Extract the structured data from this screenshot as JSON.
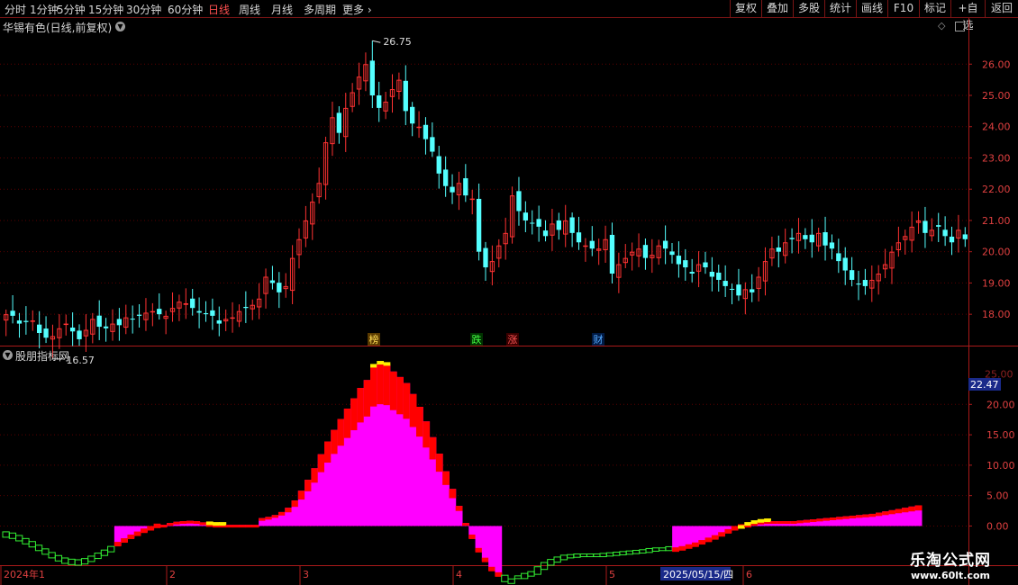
{
  "toolbar": {
    "periods": [
      "分时",
      "1分钟",
      "5分钟",
      "15分钟",
      "30分钟",
      "60分钟",
      "日线",
      "周线",
      "月线",
      "多周期",
      "更多"
    ],
    "active_period": "日线",
    "right_buttons": [
      "复权",
      "叠加",
      "多股",
      "统计",
      "画线",
      "F10",
      "标记",
      "+自选",
      "返回"
    ]
  },
  "main": {
    "title": "华锡有色(日线,前复权)",
    "high_label": "26.75",
    "low_label": "16.57",
    "y_ticks": [
      "26.00",
      "25.00",
      "24.00",
      "23.00",
      "22.00",
      "21.00",
      "20.00",
      "19.00",
      "18.00"
    ],
    "event_markers": [
      {
        "text": "榜",
        "color": "#ffdd55",
        "bg": "#5a3a00"
      },
      {
        "text": "跌",
        "color": "#44ff44",
        "bg": "#003300"
      },
      {
        "text": "涨",
        "color": "#ff5555",
        "bg": "#3a0000"
      },
      {
        "text": "财",
        "color": "#55aaff",
        "bg": "#001a44"
      }
    ]
  },
  "indicator": {
    "title": "股朋指标网",
    "current_value": "22.47",
    "y_ticks": [
      "20.00",
      "15.00",
      "10.00",
      "5.00",
      "0.00"
    ],
    "y_top_partial": "25.00"
  },
  "x_axis": {
    "labels": [
      "2024年1",
      "2",
      "3",
      "4",
      "5",
      "6"
    ],
    "cursor_date": "2025/05/15/四"
  },
  "watermark": {
    "cn": "乐淘公式网",
    "url": "www.60lt.com"
  },
  "colors": {
    "up": "#ff3232",
    "down": "#54ffff",
    "grid": "#5a0000",
    "axis": "#aa1a1a",
    "magenta": "#ff00ff",
    "red": "#ff0000",
    "yellow": "#ffee00",
    "green": "#33ee33"
  },
  "chart_data": {
    "type": "candlestick",
    "y_range": [
      17.4,
      26.9
    ],
    "high_value": 26.75,
    "low_value": 16.57,
    "close": [
      18.0,
      17.95,
      17.7,
      17.75,
      17.8,
      17.4,
      17.25,
      17.3,
      17.55,
      17.7,
      17.45,
      17.2,
      17.5,
      17.85,
      17.6,
      17.55,
      17.7,
      17.65,
      17.9,
      17.85,
      17.95,
      18.05,
      18.1,
      18.0,
      17.95,
      18.2,
      18.4,
      18.35,
      18.2,
      18.05,
      18.0,
      17.95,
      17.7,
      17.85,
      17.9,
      18.1,
      18.2,
      18.3,
      18.5,
      19.2,
      19.0,
      18.7,
      18.9,
      19.8,
      20.4,
      21.0,
      21.6,
      22.2,
      23.5,
      24.3,
      23.8,
      24.6,
      25.1,
      25.6,
      26.0,
      25.0,
      24.6,
      24.8,
      25.2,
      25.5,
      24.5,
      24.1,
      24.0,
      23.6,
      23.2,
      22.5,
      22.1,
      21.9,
      22.2,
      21.8,
      21.7,
      20.0,
      19.5,
      19.7,
      20.2,
      20.6,
      21.8,
      21.3,
      21.0,
      20.9,
      20.8,
      20.5,
      20.9,
      20.7,
      21.0,
      20.6,
      20.3,
      20.2,
      20.1,
      20.1,
      20.4,
      19.3,
      19.6,
      19.8,
      20.0,
      20.1,
      19.8,
      19.9,
      20.2,
      20.1,
      19.9,
      19.6,
      19.5,
      19.3,
      19.6,
      19.5,
      19.2,
      19.1,
      18.9,
      18.8,
      18.6,
      18.8,
      18.7,
      19.2,
      19.7,
      20.1,
      20.0,
      20.3,
      20.4,
      20.6,
      20.4,
      20.3,
      20.6,
      20.2,
      20.1,
      19.7,
      19.4,
      19.1,
      18.95,
      18.9,
      19.1,
      19.3,
      19.6,
      20.0,
      20.3,
      20.5,
      20.8,
      21.0,
      20.6,
      20.7,
      20.8,
      20.5,
      20.3,
      20.7,
      20.4
    ],
    "indicator": {
      "type": "stepped-area",
      "y_range": [
        -6,
        27
      ],
      "y_ticks": [
        25,
        20,
        15,
        10,
        5,
        0
      ],
      "series": [
        {
          "name": "",
          "color": "#ff0000",
          "values": [
            -1.4,
            -1.6,
            -2.0,
            -2.5,
            -3.0,
            -3.6,
            -4.2,
            -4.8,
            -5.3,
            -5.7,
            -5.9,
            -6.0,
            -5.8,
            -5.4,
            -4.9,
            -4.4,
            -3.8,
            -3.2,
            -2.6,
            -2.0,
            -1.5,
            -1.0,
            -0.6,
            -0.2,
            0.2,
            0.5,
            0.7,
            0.8,
            0.85,
            0.8,
            0.6,
            0.3,
            0.2,
            0.2,
            0.2,
            0.2,
            0.2,
            0.2,
            0.2,
            1.3,
            1.5,
            1.8,
            2.3,
            3.0,
            4.2,
            5.8,
            7.6,
            9.5,
            11.8,
            13.9,
            15.8,
            17.6,
            19.3,
            21.0,
            22.7,
            24.0,
            26.2,
            26.7,
            26.5,
            25.4,
            24.5,
            23.5,
            21.7,
            19.6,
            17.2,
            14.6,
            11.9,
            9.0,
            6.1,
            3.3,
            0.5,
            -2.0,
            -4.2,
            -5.8,
            -7.3,
            -8.2,
            -8.8,
            -9.1,
            -9.1,
            -8.7,
            -8.4,
            -7.6,
            -6.9,
            -6.4,
            -6.0,
            -5.7,
            -5.6,
            -5.5,
            -5.5,
            -5.5,
            -5.5,
            -5.4,
            -5.3,
            -5.2,
            -5.1,
            -5.0,
            -4.9,
            -4.8,
            -4.6,
            -4.5,
            -4.5,
            -4.3,
            -4.1,
            -3.9,
            -3.6,
            -3.3,
            -2.9,
            -2.5,
            -2.1,
            -1.6,
            -1.1,
            -0.6,
            -0.3,
            0.2,
            0.5,
            0.7,
            0.8,
            0.8,
            0.8,
            0.8,
            0.8,
            0.9,
            1.0,
            1.1,
            1.2,
            1.3,
            1.4,
            1.5,
            1.6,
            1.7,
            1.8,
            1.9,
            2.0,
            2.2,
            2.4,
            2.6,
            2.8,
            3.0,
            3.2,
            3.4
          ]
        }
      ]
    }
  }
}
